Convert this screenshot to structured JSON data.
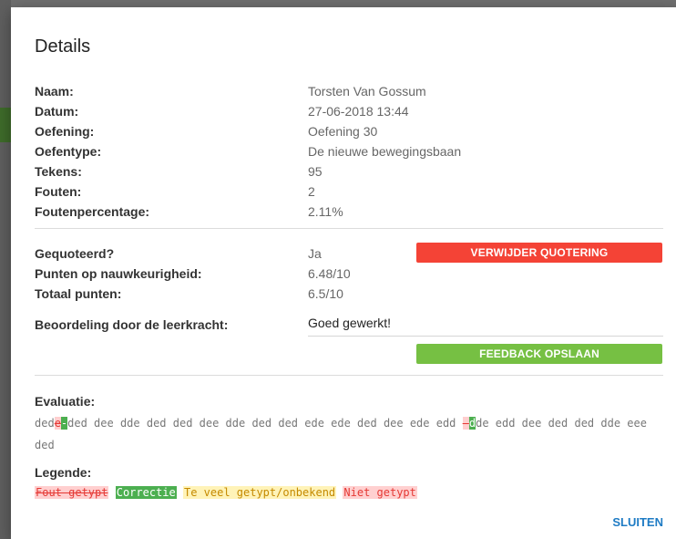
{
  "modal": {
    "title": "Details",
    "info": [
      {
        "label": "Naam:",
        "value": "Torsten Van Gossum"
      },
      {
        "label": "Datum:",
        "value": "27-06-2018 13:44"
      },
      {
        "label": "Oefening:",
        "value": "Oefening 30"
      },
      {
        "label": "Oefentype:",
        "value": "De nieuwe bewegingsbaan"
      },
      {
        "label": "Tekens:",
        "value": "95"
      },
      {
        "label": "Fouten:",
        "value": "2"
      },
      {
        "label": "Foutenpercentage:",
        "value": "2.11%"
      }
    ],
    "scoring": [
      {
        "label": "Gequoteerd?",
        "value": "Ja"
      },
      {
        "label": "Punten op nauwkeurigheid:",
        "value": "6.48/10"
      },
      {
        "label": "Totaal punten:",
        "value": "6.5/10"
      }
    ],
    "remove_quotation_label": "VERWIJDER QUOTERING",
    "teacher_review_label": "Beoordeling door de leerkracht:",
    "teacher_review_value": "Goed gewerkt!",
    "save_feedback_label": "FEEDBACK OPSLAAN",
    "evaluation": {
      "label": "Evaluatie:",
      "seg1": "ded",
      "err1": "e",
      "cor1": "-",
      "seg2": "ded dee dde ded ded dee dde ded ded ede ede ded dee ede edd ",
      "err2": "-",
      "cor2": "d",
      "seg3": "de edd dee ded ded dde eee ded"
    },
    "legend": {
      "label": "Legende:",
      "fout": "Fout getypt",
      "correctie": "Correctie",
      "teveel": "Te veel getypt/onbekend",
      "niet": "Niet getypt"
    },
    "close_label": "SLUITEN"
  },
  "colors": {
    "red_button": "#f44336",
    "green_button": "#76c043",
    "link_blue": "#1e7bc4"
  }
}
